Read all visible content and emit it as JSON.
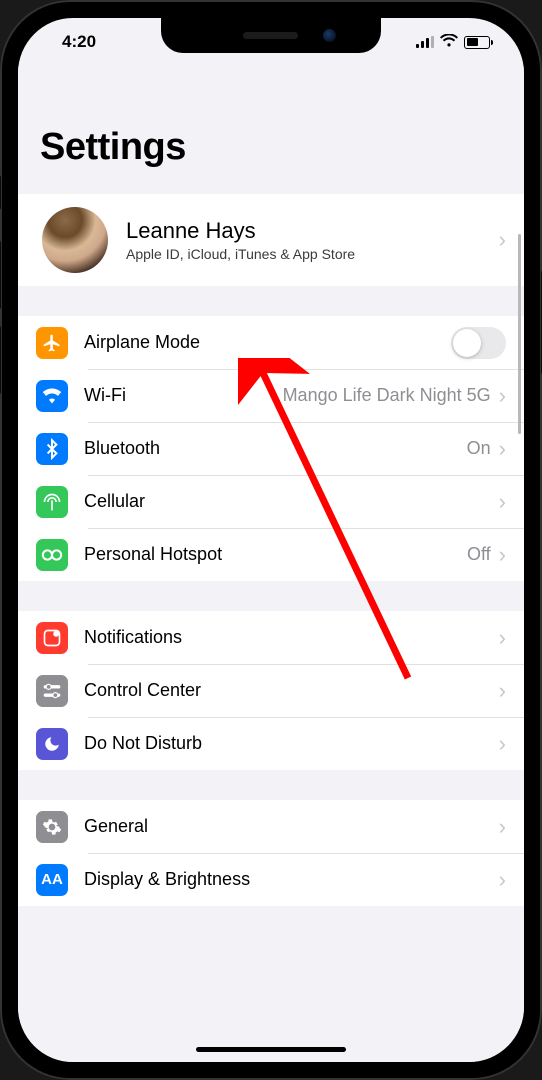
{
  "status": {
    "time": "4:20"
  },
  "page": {
    "title": "Settings"
  },
  "profile": {
    "name": "Leanne Hays",
    "subtitle": "Apple ID, iCloud, iTunes & App Store"
  },
  "groups": [
    {
      "rows": [
        {
          "label": "Airplane Mode",
          "iconColor": "#ff9500"
        },
        {
          "label": "Wi-Fi",
          "value": "Mango Life Dark Night 5G",
          "iconColor": "#007aff"
        },
        {
          "label": "Bluetooth",
          "value": "On",
          "iconColor": "#007aff"
        },
        {
          "label": "Cellular",
          "iconColor": "#34c759"
        },
        {
          "label": "Personal Hotspot",
          "value": "Off",
          "iconColor": "#34c759"
        }
      ]
    },
    {
      "rows": [
        {
          "label": "Notifications",
          "iconColor": "#ff3b30"
        },
        {
          "label": "Control Center",
          "iconColor": "#8e8e93"
        },
        {
          "label": "Do Not Disturb",
          "iconColor": "#5856d6"
        }
      ]
    },
    {
      "rows": [
        {
          "label": "General",
          "iconColor": "#8e8e93"
        },
        {
          "label": "Display & Brightness",
          "iconColor": "#007aff"
        }
      ]
    }
  ]
}
